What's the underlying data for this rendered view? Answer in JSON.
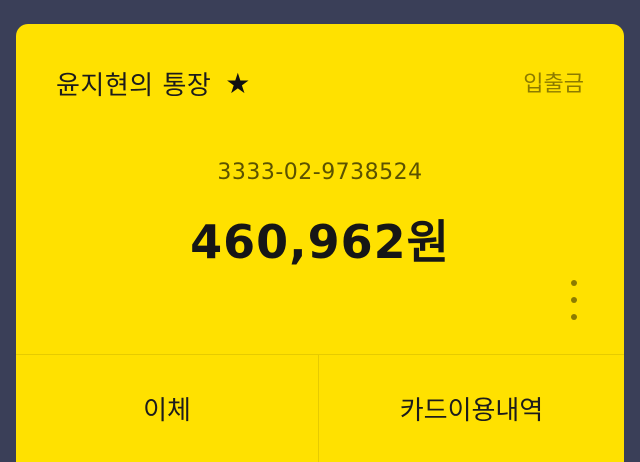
{
  "account": {
    "name": "윤지현의 통장",
    "favorite_icon": "★",
    "deposit_withdraw_label": "입출금",
    "number": "3333-02-9738524",
    "balance": "460,962원"
  },
  "actions": {
    "transfer_label": "이체",
    "card_history_label": "카드이용내역"
  },
  "colors": {
    "card_background": "#FFE100",
    "page_background": "#3a3f58",
    "muted_text": "#8c7b00"
  },
  "icons": {
    "favorite": "star-icon",
    "more": "more-vertical-icon"
  }
}
